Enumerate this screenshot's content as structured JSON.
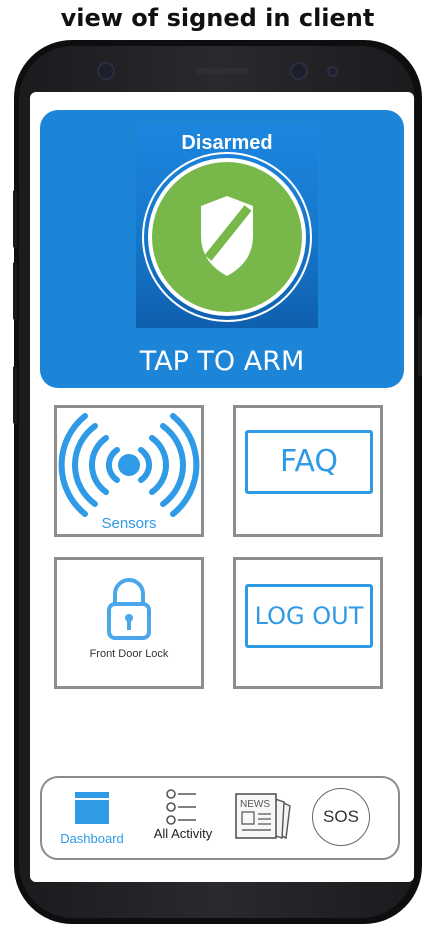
{
  "caption": "view of signed in client",
  "status_panel": {
    "status": "Disarmed",
    "action": "TAP TO ARM",
    "shield_color": "#78b84a",
    "panel_color": "#1c85d8",
    "icon": "shield-icon"
  },
  "tiles": {
    "sensors": {
      "label": "Sensors",
      "icon": "sensor-signal-icon"
    },
    "faq": {
      "label": "FAQ"
    },
    "lock": {
      "label": "Front Door Lock",
      "icon": "padlock-icon"
    },
    "logout": {
      "label": "LOG OUT"
    }
  },
  "nav": {
    "dashboard": {
      "label": "Dashboard",
      "icon": "dashboard-icon",
      "active": true
    },
    "activity": {
      "label": "All Activity",
      "icon": "list-icon"
    },
    "news": {
      "label": "NEWS",
      "icon": "newspaper-icon"
    },
    "sos": {
      "label": "SOS"
    }
  },
  "accent_color": "#2f9ae6"
}
